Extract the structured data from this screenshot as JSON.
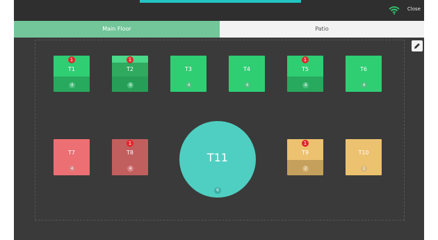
{
  "topbar": {
    "close_label": "Close",
    "wifi_icon": "wifi-icon"
  },
  "tabs": [
    {
      "label": "Main Floor"
    },
    {
      "label": "Patio"
    }
  ],
  "edit_icon": "pencil-icon",
  "tables": [
    {
      "name": "T1",
      "seats": "4",
      "badge": "1"
    },
    {
      "name": "T2",
      "seats": "4",
      "badge": "1"
    },
    {
      "name": "T3",
      "seats": "4"
    },
    {
      "name": "T4",
      "seats": "4"
    },
    {
      "name": "T5",
      "seats": "4",
      "badge": "1"
    },
    {
      "name": "T6",
      "seats": "4"
    },
    {
      "name": "T7",
      "seats": "4"
    },
    {
      "name": "T8",
      "seats": "4",
      "badge": "1"
    },
    {
      "name": "T9",
      "seats": "2",
      "badge": "1"
    },
    {
      "name": "T10",
      "seats": "2"
    },
    {
      "name": "T11",
      "seats": "6"
    }
  ]
}
